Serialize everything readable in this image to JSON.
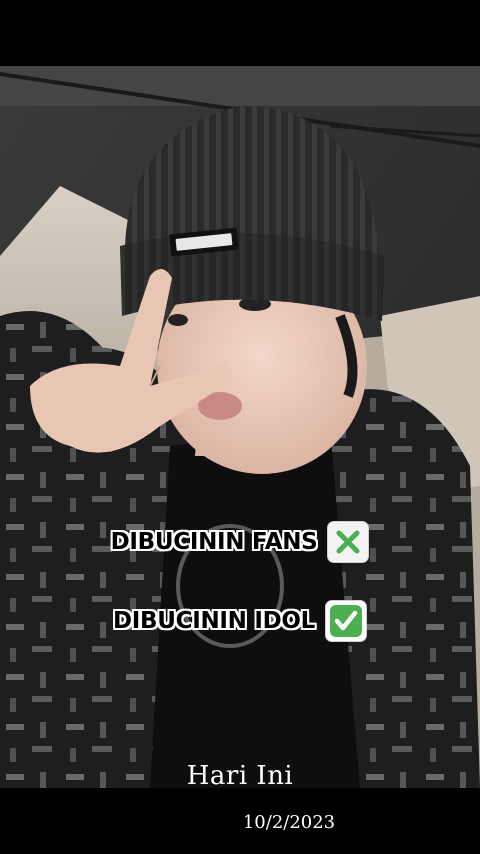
{
  "overlay": {
    "line1": {
      "text": "DIBUCININ FANS",
      "icon": "cross-mark-icon"
    },
    "line2": {
      "text": "DIBUCININ IDOL",
      "icon": "check-mark-icon"
    }
  },
  "footer": {
    "title": "Hari Ini",
    "date": "10/2/2023"
  },
  "colors": {
    "cross": "#4caf50",
    "check": "#43b04a",
    "caption_text": "#000000",
    "caption_outline": "#ffffff"
  }
}
